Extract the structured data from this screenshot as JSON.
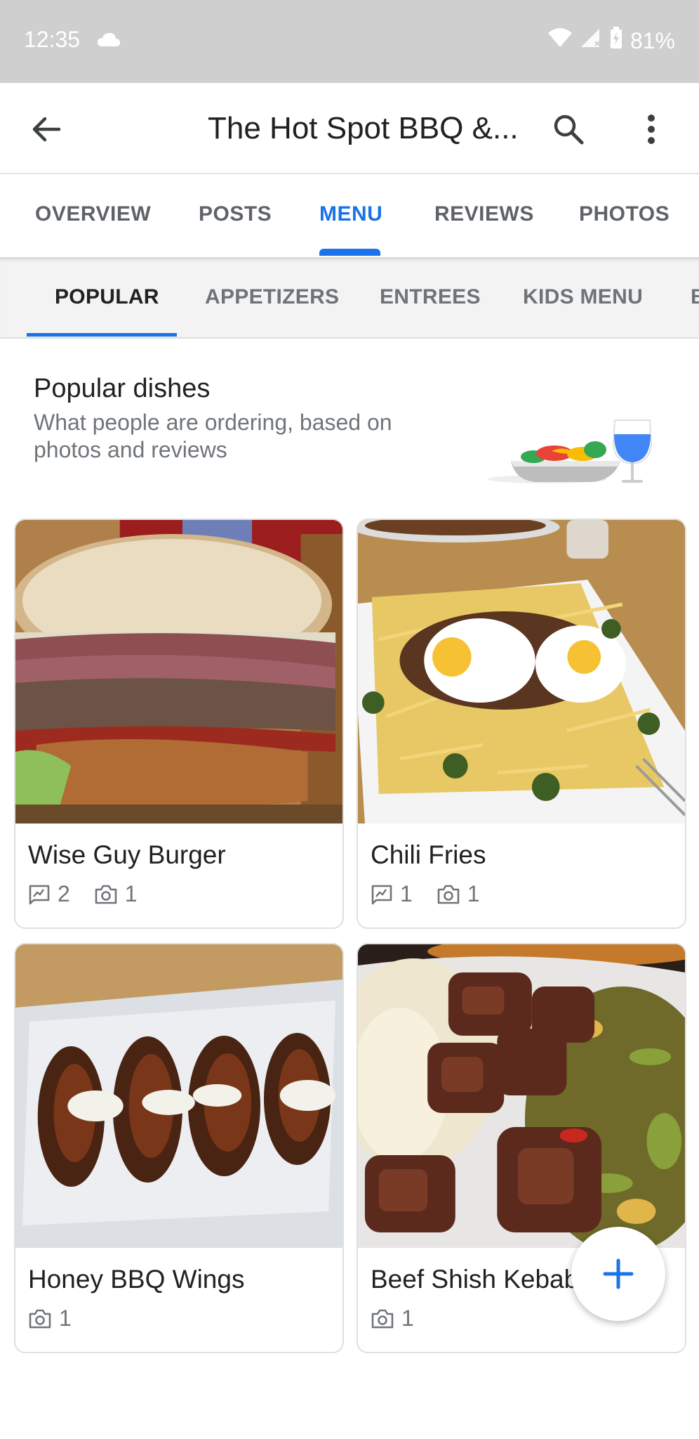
{
  "status_bar": {
    "time": "12:35",
    "battery": "81%"
  },
  "app_bar": {
    "title": "The Hot Spot BBQ &..."
  },
  "main_tabs": [
    "OVERVIEW",
    "POSTS",
    "MENU",
    "REVIEWS",
    "PHOTOS"
  ],
  "main_tabs_active": "MENU",
  "sub_tabs": [
    "POPULAR",
    "APPETIZERS",
    "ENTREES",
    "KIDS MENU",
    "B"
  ],
  "sub_tabs_active": "POPULAR",
  "popular": {
    "title": "Popular dishes",
    "subtitle": "What people are ordering, based on photos and reviews"
  },
  "dishes": [
    {
      "name": "Wise Guy Burger",
      "reviews": "2",
      "photos": "1"
    },
    {
      "name": "Chili Fries",
      "reviews": "1",
      "photos": "1"
    },
    {
      "name": "Honey BBQ Wings",
      "photos": "1"
    },
    {
      "name": "Beef Shish Kebab",
      "photos": "1"
    }
  ],
  "colors": {
    "accent": "#1a73e8",
    "status_bar": "#cfcfcf",
    "text_secondary": "#70757a"
  }
}
